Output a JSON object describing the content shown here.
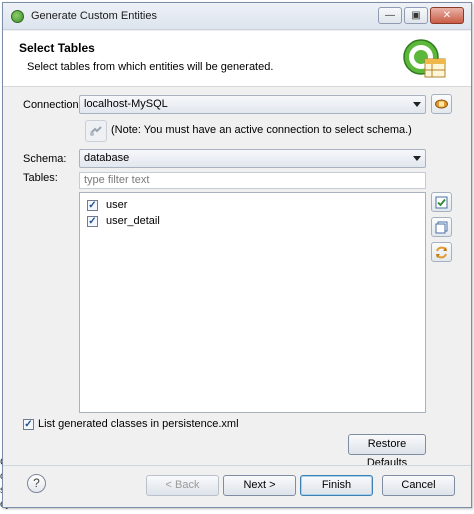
{
  "window": {
    "title": "Generate Custom Entities",
    "minimize_glyph": "—",
    "restore_glyph": "▣",
    "close_glyph": "✕"
  },
  "header": {
    "title": "Select Tables",
    "description": "Select tables from which entities will be generated."
  },
  "connection": {
    "label": "Connection:",
    "value": "localhost-MySQL",
    "note": "(Note: You must have an active connection to select schema.)"
  },
  "schema": {
    "label": "Schema:",
    "value": "database"
  },
  "tables": {
    "label": "Tables:",
    "filter_placeholder": "type filter text",
    "items": [
      {
        "name": "user",
        "checked": true
      },
      {
        "name": "user_detail",
        "checked": true
      }
    ]
  },
  "options": {
    "list_classes_label": "List generated classes in persistence.xml",
    "list_classes_checked": true,
    "restore_defaults_label": "Restore Defaults"
  },
  "footer": {
    "help_glyph": "?",
    "back_label": "< Back",
    "next_label": "Next >",
    "finish_label": "Finish",
    "cancel_label": "Cancel"
  },
  "background_text": [
    "Ch",
    "or",
    "ss",
    "ey"
  ],
  "icons": {
    "title": "wizard-icon",
    "connect": "connection-settings-icon",
    "reconnect": "reconnect-icon",
    "select_all": "select-all-icon",
    "deselect_all": "deselect-all-icon",
    "refresh": "refresh-icon"
  },
  "colors": {
    "accent": "#3c7fb1",
    "check": "#1f4f8f",
    "logo_green": "#5cb83a"
  }
}
